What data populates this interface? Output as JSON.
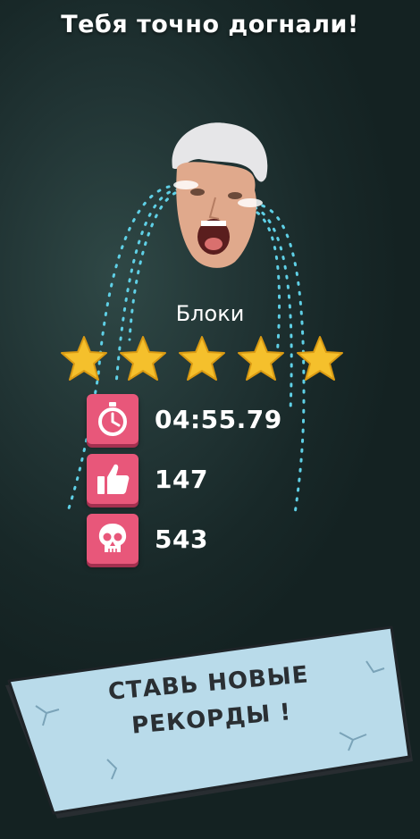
{
  "header": {
    "title": "Тебя точно догнали!"
  },
  "level": {
    "name": "Блоки",
    "stars_earned": 5,
    "stars_total": 5
  },
  "stats": {
    "time": "04:55.79",
    "likes": "147",
    "deaths": "543"
  },
  "banner": {
    "line1": "СТАВЬ НОВЫЕ",
    "line2": "РЕКОРДЫ !"
  },
  "colors": {
    "background": "#1b2c2c",
    "star": "#f5c02c",
    "stat_icon": "#e8577a",
    "banner": "#b9dbea",
    "tears": "#5fd0e6"
  },
  "icons": [
    "stopwatch-icon",
    "thumbs-up-icon",
    "skull-icon",
    "star-icon"
  ]
}
